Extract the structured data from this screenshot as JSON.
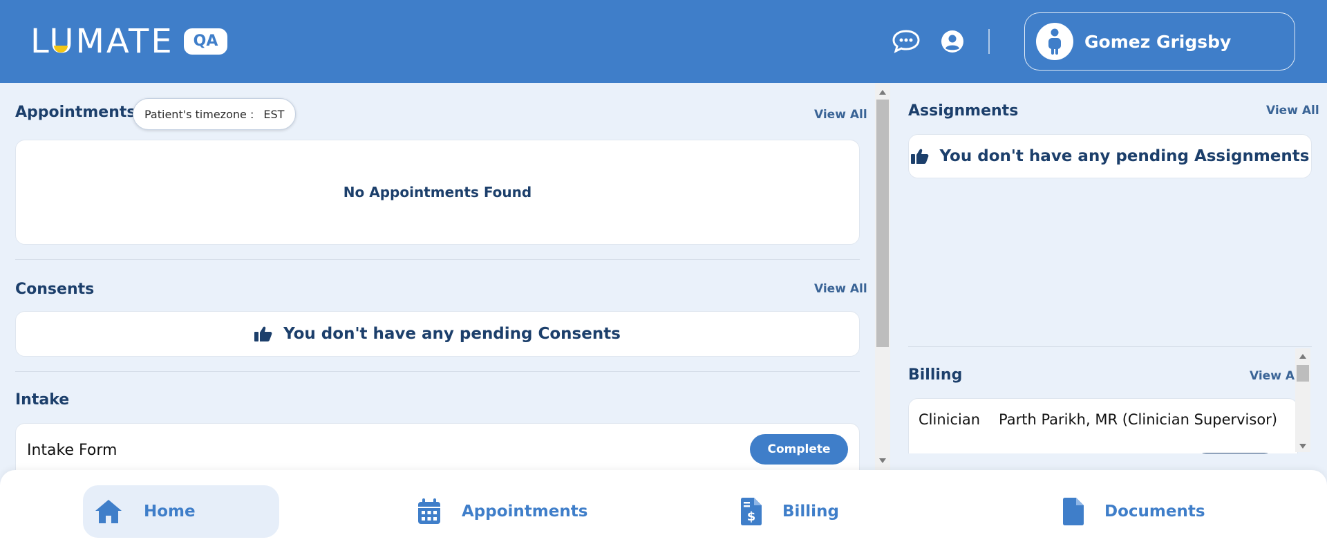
{
  "header": {
    "logo_text": "LUMATE",
    "env_badge": "QA",
    "user_name": "Gomez Grigsby"
  },
  "appointments": {
    "title": "Appointments",
    "timezone_label": "Patient's timezone :",
    "timezone_value": "EST",
    "view_all": "View All",
    "empty_text": "No Appointments Found"
  },
  "consents": {
    "title": "Consents",
    "view_all": "View All",
    "empty_text": "You don't have any pending Consents"
  },
  "intake": {
    "title": "Intake",
    "form_name": "Intake Form",
    "button_label": "Complete"
  },
  "assignments": {
    "title": "Assignments",
    "view_all": "View All",
    "empty_text": "You don't have any pending Assignments"
  },
  "billing": {
    "title": "Billing",
    "view_all": "View All",
    "row_label": "Clinician",
    "row_value": "Parth Parikh, MR (Clinician Supervisor)"
  },
  "bottom_nav": {
    "items": [
      {
        "label": "Home",
        "icon": "home-icon",
        "active": true
      },
      {
        "label": "Appointments",
        "icon": "calendar-icon",
        "active": false
      },
      {
        "label": "Billing",
        "icon": "invoice-dollar-icon",
        "active": false
      },
      {
        "label": "Documents",
        "icon": "document-icon",
        "active": false
      }
    ]
  },
  "colors": {
    "brand_blue": "#3f7ec9",
    "page_bg": "#eaf1fa",
    "text_navy": "#1c3f6b",
    "logo_accent": "#f3c614"
  }
}
